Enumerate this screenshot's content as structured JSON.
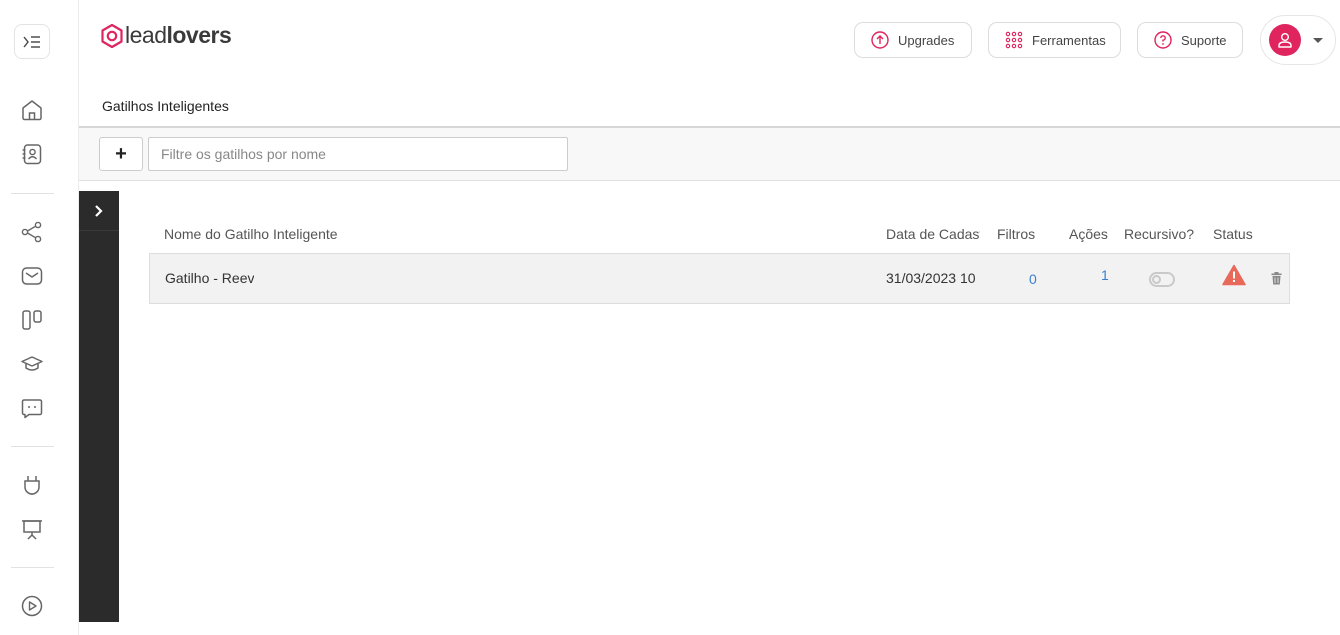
{
  "app": {
    "logo_lead": "lead",
    "logo_lovers": "lovers",
    "brand_color": "#e0245e"
  },
  "sidebar": {
    "items": [
      {
        "name": "home-icon"
      },
      {
        "name": "contacts-icon"
      },
      {
        "name": "flow-icon"
      },
      {
        "name": "email-icon"
      },
      {
        "name": "kanban-icon"
      },
      {
        "name": "course-icon"
      },
      {
        "name": "chat-icon"
      },
      {
        "name": "plug-icon"
      },
      {
        "name": "presentation-icon"
      },
      {
        "name": "play-icon"
      }
    ]
  },
  "header": {
    "upgrades_label": "Upgrades",
    "tools_label": "Ferramentas",
    "support_label": "Suporte"
  },
  "page": {
    "title": "Gatilhos Inteligentes"
  },
  "toolbar": {
    "add_label": "+",
    "filter_placeholder": "Filtre os gatilhos por nome"
  },
  "table": {
    "columns": {
      "name": "Nome do Gatilho Inteligente",
      "date": "Data de Cadastro",
      "filters": "Filtros",
      "actions": "Ações",
      "recursive": "Recursivo?",
      "status": "Status"
    },
    "rows": [
      {
        "name": "Gatilho - Reev",
        "date": "31/03/2023 10",
        "filters": "0",
        "actions": "1",
        "recursive": false,
        "status": "warning-icon"
      }
    ]
  }
}
